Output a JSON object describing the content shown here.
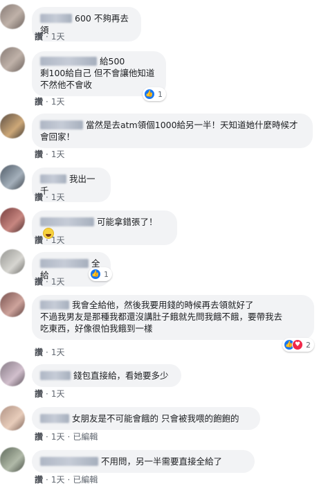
{
  "comments": [
    {
      "text": "600 不夠再去領",
      "like_label": "讚",
      "time": "1天"
    },
    {
      "text": "給500\n剩100給自己 但不會讓他知道\n不然他不會收",
      "like_label": "讚",
      "time": "1天",
      "reactions": "1"
    },
    {
      "text": "當然是去atm領個1000給另一半！天知道她什麼時候才\n會回家！",
      "like_label": "讚",
      "time": "1天"
    },
    {
      "text": "我出一千",
      "like_label": "讚",
      "time": "1天"
    },
    {
      "text": "可能拿錯張了！",
      "like_label": "讚",
      "time": "1天",
      "emoji": "laughing-face-icon"
    },
    {
      "text": "全給",
      "like_label": "讚",
      "time": "1天",
      "reactions": "1"
    },
    {
      "text": "我會全給他，然後我要用錢的時候再去領就好了\n不過我男友是那種我都還沒講肚子餓就先問我餓不餓，要帶我去\n吃東西，好像很怕我餓到一樣",
      "like_label": "讚",
      "time": "1天",
      "reactions": "2"
    },
    {
      "text": "錢包直接給，看她要多少",
      "like_label": "讚",
      "time": "1天"
    },
    {
      "text": "女朋友是不可能會餓的 只會被我喂的飽飽的",
      "like_label": "讚",
      "time": "1天",
      "edited": "已編輯"
    },
    {
      "text": "不用問，另一半需要直接全給了",
      "like_label": "讚",
      "time": "1天",
      "edited": "已編輯"
    }
  ],
  "colors": {
    "bubble": "#f2f3f5",
    "like_blue": "#1877f2",
    "love_red": "#f0284a",
    "meta_gray": "#606770"
  }
}
